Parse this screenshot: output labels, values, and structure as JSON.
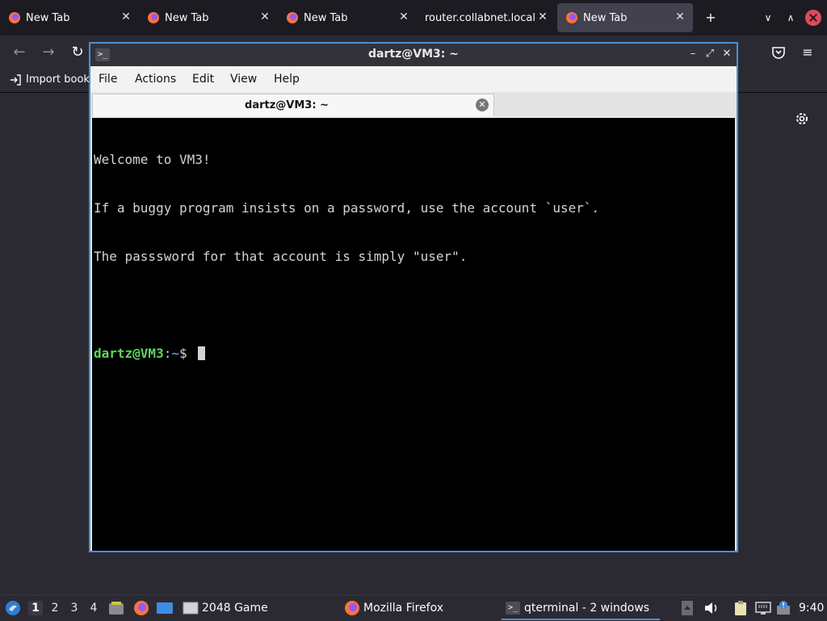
{
  "browser": {
    "tabs": [
      {
        "title": "New Tab",
        "active": false
      },
      {
        "title": "New Tab",
        "active": false
      },
      {
        "title": "New Tab",
        "active": false
      },
      {
        "title": "router.collabnet.local/",
        "active": false
      },
      {
        "title": "New Tab",
        "active": true
      }
    ],
    "bookmarks_import_label": "Import book"
  },
  "terminal": {
    "window_title": "dartz@VM3: ~",
    "menu": [
      "File",
      "Actions",
      "Edit",
      "View",
      "Help"
    ],
    "tab_title": "dartz@VM3: ~",
    "lines": [
      "Welcome to VM3!",
      "If a buggy program insists on a password, use the account `user`.",
      "The passsword for that account is simply \"user\"."
    ],
    "prompt": {
      "user_host": "dartz@VM3",
      "sep": ":",
      "path": "~",
      "symbol": "$ "
    }
  },
  "taskbar": {
    "workspaces": [
      "1",
      "2",
      "3",
      "4"
    ],
    "current_workspace": "1",
    "tasks": [
      {
        "label": "2048 Game"
      },
      {
        "label": "Mozilla Firefox"
      },
      {
        "label": "qterminal - 2 windows"
      }
    ],
    "clock": "9:40"
  },
  "colors": {
    "accent": "#4a90d9",
    "prompt_user": "#5cd65c",
    "prompt_path": "#5c8ad6",
    "close": "#e04a5a"
  }
}
